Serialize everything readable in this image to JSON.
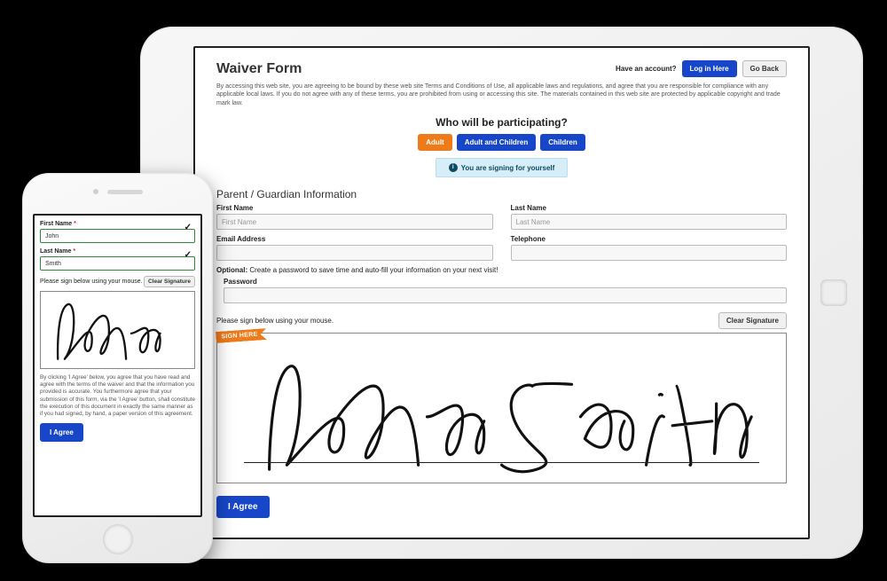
{
  "tablet": {
    "title": "Waiver Form",
    "account_q": "Have an account?",
    "login_btn": "Log in Here",
    "back_btn": "Go Back",
    "terms": "By accessing this web site, you are agreeing to be bound by these web site Terms and Conditions of Use, all applicable laws and regulations, and agree that you are responsible for compliance with any applicable local laws. If you do not agree with any of these terms, you are prohibited from using or accessing this site. The materials contained in this web site are protected by applicable copyright and trade mark law.",
    "who_heading": "Who will be participating?",
    "pills": {
      "adult": "Adult",
      "both": "Adult and Children",
      "children": "Children"
    },
    "self_note": "You are signing for yourself",
    "section_heading": "Parent / Guardian Information",
    "labels": {
      "first": "First Name",
      "last": "Last Name",
      "email": "Email Address",
      "phone": "Telephone",
      "password": "Password"
    },
    "placeholders": {
      "first": "First Name",
      "last": "Last Name"
    },
    "optional_lead": "Optional:",
    "optional_rest": " Create a password to save time and auto-fill your information on your next visit!",
    "sign_hint": "Please sign below using your mouse.",
    "clear_btn": "Clear Signature",
    "sign_here": "SIGN HERE",
    "agree_btn": "I Agree"
  },
  "phone": {
    "first_label": "First Name",
    "first_value": "John",
    "last_label": "Last Name",
    "last_value": "Smith",
    "required_mark": "*",
    "sign_hint": "Please sign below using your mouse.",
    "clear_btn": "Clear Signature",
    "disclaimer": "By clicking 'I Agree' below, you agree that you have read and agree with the terms of the waiver and that the information you provided is accurate. You furthermore agree that your submission of this form, via the 'I Agree' button, shall constitute the execution of this document in exactly the same manner as if you had signed, by hand, a paper version of this agreement.",
    "agree_btn": "I Agree"
  }
}
